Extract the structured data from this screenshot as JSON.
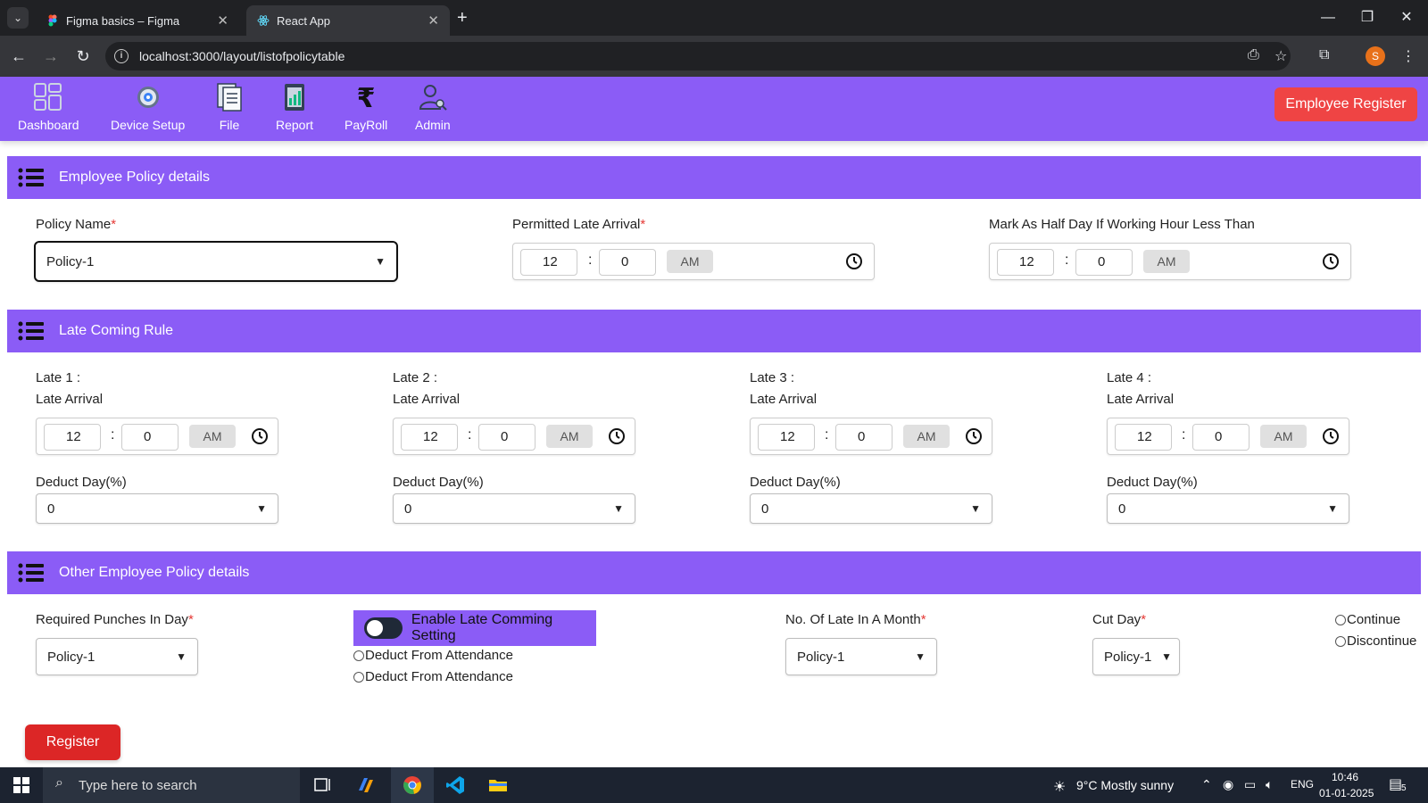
{
  "browser": {
    "tabs": [
      {
        "title": "Figma basics – Figma",
        "active": false
      },
      {
        "title": "React App",
        "active": true
      }
    ],
    "url": "localhost:3000/layout/listofpolicytable",
    "profile_initial": "S"
  },
  "nav": {
    "items": [
      {
        "label": "Dashboard",
        "icon": "dashboard-icon"
      },
      {
        "label": "Device Setup",
        "icon": "gear-icon"
      },
      {
        "label": "File",
        "icon": "file-icon"
      },
      {
        "label": "Report",
        "icon": "report-icon"
      },
      {
        "label": "PayRoll",
        "icon": "rupee-icon"
      },
      {
        "label": "Admin",
        "icon": "admin-icon"
      }
    ],
    "register_button": "Employee Register"
  },
  "sections": {
    "policy": "Employee Policy details",
    "late": "Late Coming Rule",
    "other": "Other Employee Policy details"
  },
  "policy_details": {
    "policy_name_label": "Policy Name",
    "policy_name_value": "Policy-1",
    "permitted_late_label": "Permitted Late Arrival",
    "permitted_late": {
      "hour": "12",
      "minute": "0",
      "ampm": "AM"
    },
    "half_day_label": "Mark As Half Day If Working Hour Less Than",
    "half_day": {
      "hour": "12",
      "minute": "0",
      "ampm": "AM"
    }
  },
  "late_rules": [
    {
      "title": "Late 1 :",
      "arrival_label": "Late Arrival",
      "hour": "12",
      "minute": "0",
      "ampm": "AM",
      "deduct_label": "Deduct Day(%)",
      "deduct_value": "0"
    },
    {
      "title": "Late 2 :",
      "arrival_label": "Late Arrival",
      "hour": "12",
      "minute": "0",
      "ampm": "AM",
      "deduct_label": "Deduct Day(%)",
      "deduct_value": "0"
    },
    {
      "title": "Late 3 :",
      "arrival_label": "Late Arrival",
      "hour": "12",
      "minute": "0",
      "ampm": "AM",
      "deduct_label": "Deduct Day(%)",
      "deduct_value": "0"
    },
    {
      "title": "Late 4 :",
      "arrival_label": "Late Arrival",
      "hour": "12",
      "minute": "0",
      "ampm": "AM",
      "deduct_label": "Deduct Day(%)",
      "deduct_value": "0"
    }
  ],
  "other": {
    "punches_label": "Required Punches In Day",
    "punches_value": "Policy-1",
    "toggle_label": "Enable Late Comming Setting",
    "radio_deduct": [
      "Deduct From Attendance",
      "Deduct From Attendance"
    ],
    "late_month_label": "No. Of Late In A Month",
    "late_month_value": "Policy-1",
    "cut_day_label": "Cut Day",
    "cut_day_value": "Policy-1",
    "radio_continue": [
      "Continue",
      "Discontinue"
    ]
  },
  "register_label": "Register",
  "taskbar": {
    "search_placeholder": "Type here to search",
    "weather": "9°C  Mostly sunny",
    "lang": "ENG",
    "time": "10:46",
    "date": "01-01-2025",
    "notif_count": "5"
  },
  "colors": {
    "accent": "#8b5cf6",
    "danger": "#ef4444"
  }
}
